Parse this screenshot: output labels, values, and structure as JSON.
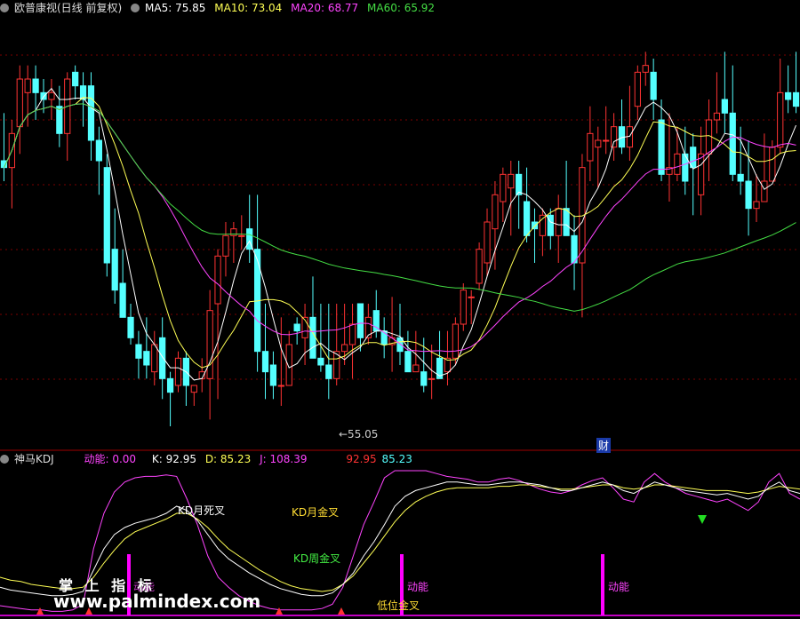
{
  "header": {
    "title": "欧普康视(日线 前复权)",
    "ma": [
      {
        "label": "MA5: 75.85",
        "color": "#ffffff"
      },
      {
        "label": "MA10: 73.04",
        "color": "#ffff55"
      },
      {
        "label": "MA20: 68.77",
        "color": "#ff44ff"
      },
      {
        "label": "MA60: 65.92",
        "color": "#44dd44"
      }
    ]
  },
  "price_chart": {
    "low_marker": "←55.05",
    "finance_marker": "财",
    "candles": [
      [
        79,
        78,
        86,
        76
      ],
      [
        78,
        83,
        85,
        72
      ],
      [
        84,
        91,
        93,
        80
      ],
      [
        89,
        91,
        93,
        84
      ],
      [
        91,
        89,
        93,
        85
      ],
      [
        89,
        88,
        91,
        86
      ],
      [
        88,
        89,
        91,
        85
      ],
      [
        87,
        83,
        90,
        81
      ],
      [
        83,
        91,
        92,
        79
      ],
      [
        92,
        90,
        93,
        88
      ],
      [
        90,
        88,
        92,
        84
      ],
      [
        90,
        82,
        92,
        79
      ],
      [
        82,
        79,
        84,
        74
      ],
      [
        78,
        64,
        80,
        62
      ],
      [
        66,
        60,
        72,
        58
      ],
      [
        61,
        56,
        66,
        56
      ],
      [
        56,
        53,
        58,
        52
      ],
      [
        52,
        50,
        54,
        47
      ],
      [
        51,
        49,
        56,
        47
      ],
      [
        48,
        52,
        54,
        46
      ],
      [
        53,
        47,
        56,
        44
      ],
      [
        47,
        45,
        48,
        40
      ],
      [
        46,
        50,
        51,
        45
      ],
      [
        50,
        46,
        51,
        43
      ],
      [
        45,
        46,
        46,
        43
      ],
      [
        47,
        48,
        50,
        45
      ],
      [
        47,
        57,
        60,
        41
      ],
      [
        58,
        65,
        66,
        44
      ],
      [
        65,
        68,
        70,
        62
      ],
      [
        68,
        69,
        70,
        64
      ],
      [
        68,
        68,
        71,
        66
      ],
      [
        69,
        66,
        74,
        64
      ],
      [
        66,
        51,
        74,
        48
      ],
      [
        51,
        48,
        58,
        44
      ],
      [
        49,
        46,
        51,
        44
      ],
      [
        46,
        46,
        56,
        43
      ],
      [
        46,
        52,
        54,
        46
      ],
      [
        55,
        54,
        56,
        52
      ],
      [
        53,
        56,
        58,
        49
      ],
      [
        56,
        50,
        62,
        50
      ],
      [
        50,
        49,
        58,
        48
      ],
      [
        49,
        47,
        58,
        44
      ],
      [
        47,
        51,
        58,
        46
      ],
      [
        51,
        52,
        58,
        49
      ],
      [
        52,
        55,
        58,
        47
      ],
      [
        58,
        53,
        56,
        51
      ],
      [
        53,
        56,
        58,
        52
      ],
      [
        57,
        54,
        60,
        53
      ],
      [
        54,
        52,
        56,
        50
      ],
      [
        52,
        53,
        59,
        48
      ],
      [
        53,
        51,
        58,
        49
      ],
      [
        51,
        48,
        54,
        48
      ],
      [
        48,
        49,
        54,
        48
      ],
      [
        48,
        46,
        53,
        45
      ],
      [
        47,
        47,
        52,
        44
      ],
      [
        50,
        47,
        54,
        49
      ],
      [
        48,
        50,
        54,
        46
      ],
      [
        50,
        55,
        56,
        49
      ],
      [
        55,
        60,
        61,
        54
      ],
      [
        59,
        59,
        60,
        55
      ],
      [
        61,
        66,
        67,
        60
      ],
      [
        64,
        70,
        72,
        62
      ],
      [
        69,
        74,
        76,
        63
      ],
      [
        73,
        77,
        78,
        70
      ],
      [
        75,
        77,
        79,
        68
      ],
      [
        77,
        74,
        79,
        69
      ],
      [
        73,
        68,
        78,
        67
      ],
      [
        70,
        69,
        72,
        64
      ],
      [
        68,
        71,
        72,
        65
      ],
      [
        71,
        68,
        72,
        66
      ],
      [
        68,
        72,
        74,
        64
      ],
      [
        72,
        68,
        79,
        68
      ],
      [
        68,
        64,
        71,
        60
      ],
      [
        64,
        78,
        80,
        56
      ],
      [
        79,
        83,
        87,
        76
      ],
      [
        81,
        82,
        84,
        75
      ],
      [
        82,
        82,
        87,
        80
      ],
      [
        81,
        84,
        86,
        79
      ],
      [
        84,
        81,
        88,
        80
      ],
      [
        81,
        84,
        90,
        79
      ],
      [
        87,
        92,
        93,
        85
      ],
      [
        92,
        93,
        95,
        90
      ],
      [
        92,
        88,
        94,
        85
      ],
      [
        85,
        77,
        88,
        76
      ],
      [
        77,
        78,
        86,
        73
      ],
      [
        77,
        80,
        84,
        76
      ],
      [
        80,
        76,
        84,
        74
      ],
      [
        81,
        78,
        83,
        71
      ],
      [
        74,
        80,
        84,
        71
      ],
      [
        80,
        85,
        88,
        76
      ],
      [
        85,
        86,
        92,
        83
      ],
      [
        88,
        86,
        95,
        83
      ],
      [
        86,
        77,
        93,
        76
      ],
      [
        77,
        76,
        84,
        74
      ],
      [
        76,
        72,
        82,
        68
      ],
      [
        72,
        73,
        77,
        70
      ],
      [
        73,
        76,
        83,
        73
      ],
      [
        76,
        81,
        82,
        76
      ],
      [
        81,
        89,
        94,
        80
      ],
      [
        89,
        88,
        93,
        86
      ],
      [
        89,
        87,
        95,
        86
      ]
    ]
  },
  "kdj": {
    "title": "神马KDJ",
    "energy_label": "动能: 0.00",
    "k_label": "K: 92.95",
    "d_label": "D: 85.23",
    "j_label": "J: 108.39",
    "v1_label": "92.95",
    "v2_label": "85.23",
    "annotations": {
      "kd_month_death": "KD月死叉",
      "kd_month_gold": "KD月金叉",
      "kd_week_gold": "KD周金叉",
      "energy1": "动能",
      "energy2": "动能",
      "energy3": "动能",
      "low_gold": "低位金叉"
    },
    "k": [
      18,
      16,
      15,
      14,
      13,
      12,
      12,
      13,
      15,
      30,
      45,
      55,
      60,
      63,
      65,
      67,
      70,
      75,
      72,
      65,
      55,
      45,
      38,
      33,
      28,
      24,
      20,
      17,
      15,
      13,
      12,
      12,
      14,
      20,
      28,
      40,
      50,
      62,
      75,
      82,
      86,
      88,
      90,
      92,
      92,
      91,
      90,
      90,
      91,
      92,
      92,
      91,
      90,
      88,
      86,
      86,
      88,
      90,
      92,
      90,
      86,
      84,
      88,
      92,
      90,
      88,
      86,
      85,
      84,
      83,
      84,
      82,
      80,
      82,
      88,
      92,
      86,
      84
    ],
    "d": [
      25,
      23,
      22,
      20,
      19,
      18,
      17,
      17,
      18,
      25,
      35,
      44,
      52,
      57,
      60,
      63,
      66,
      70,
      70,
      66,
      60,
      52,
      45,
      40,
      35,
      30,
      26,
      22,
      19,
      17,
      16,
      15,
      16,
      20,
      26,
      35,
      44,
      54,
      64,
      72,
      78,
      82,
      85,
      87,
      88,
      88,
      88,
      88,
      89,
      89,
      90,
      90,
      89,
      88,
      87,
      87,
      88,
      89,
      90,
      90,
      88,
      87,
      88,
      90,
      90,
      89,
      88,
      87,
      86,
      86,
      86,
      85,
      84,
      85,
      87,
      89,
      88,
      87
    ],
    "j": [
      5,
      4,
      3,
      2,
      2,
      1,
      1,
      2,
      6,
      45,
      70,
      85,
      92,
      95,
      96,
      96,
      97,
      96,
      80,
      62,
      40,
      25,
      18,
      12,
      8,
      5,
      3,
      2,
      2,
      2,
      2,
      3,
      6,
      18,
      40,
      62,
      78,
      95,
      100,
      100,
      100,
      100,
      98,
      96,
      95,
      94,
      92,
      92,
      94,
      95,
      93,
      90,
      87,
      85,
      84,
      86,
      90,
      93,
      95,
      88,
      80,
      78,
      92,
      98,
      92,
      88,
      84,
      82,
      80,
      78,
      80,
      76,
      72,
      78,
      92,
      98,
      84,
      80
    ],
    "energy_bars": [
      145,
      452,
      678
    ],
    "red_arrows": [
      45,
      100,
      314,
      384
    ],
    "green_arrow": 790
  },
  "watermark": {
    "line1": "掌 上 指 标",
    "line2": "www.palmindex.com"
  },
  "colors": {
    "up": "#ff3333",
    "down": "#54ffff",
    "ma5": "#ffffff",
    "ma10": "#ffff55",
    "ma20": "#ff44ff",
    "ma60": "#44dd44",
    "grid": "#7a0000"
  }
}
